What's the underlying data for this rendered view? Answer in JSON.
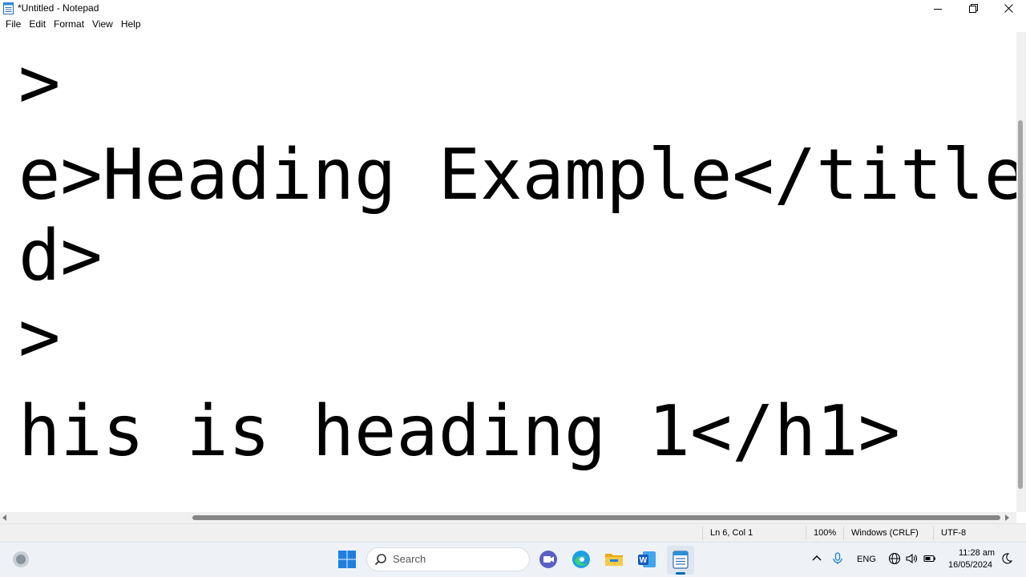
{
  "window": {
    "title": "*Untitled - Notepad"
  },
  "menu": [
    "File",
    "Edit",
    "Format",
    "View",
    "Help"
  ],
  "editor": {
    "lines": [
      ">",
      "e>Heading Example</title>",
      "d>",
      ">",
      "his is heading 1</h1>"
    ]
  },
  "status": {
    "position": "Ln 6, Col 1",
    "zoom": "100%",
    "line_ending": "Windows (CRLF)",
    "encoding": "UTF-8"
  },
  "taskbar": {
    "search_label": "Search",
    "language": "ENG",
    "time": "11:28 am",
    "date": "16/05/2024"
  },
  "colors": {
    "accent": "#0067c0",
    "taskbar_bg": "#eef2f7"
  }
}
